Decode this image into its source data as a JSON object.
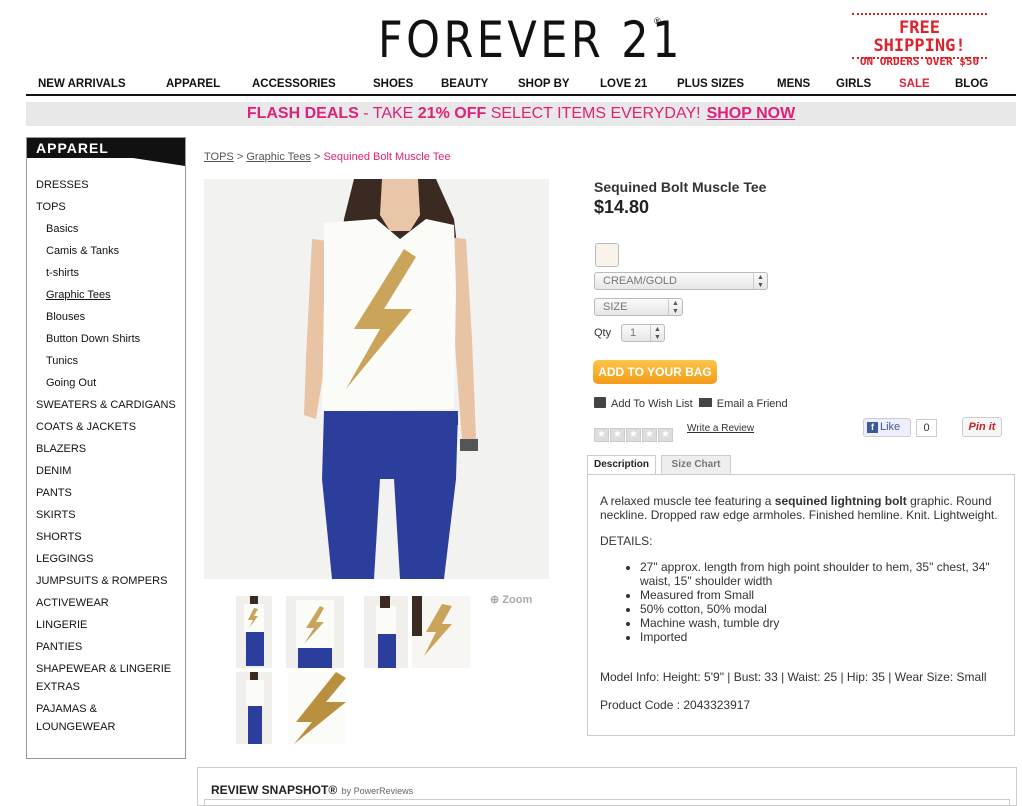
{
  "header": {
    "logo": "FOREVER 21",
    "logo_reg": "®",
    "shipping_line1": "FREE SHIPPING!",
    "shipping_line2": "ON ORDERS OVER $50"
  },
  "nav": {
    "items": [
      "NEW ARRIVALS",
      "APPAREL",
      "ACCESSORIES",
      "SHOES",
      "BEAUTY",
      "SHOP BY",
      "LOVE 21",
      "PLUS SIZES",
      "MENS",
      "GIRLS",
      "SALE",
      "BLOG"
    ]
  },
  "flash": {
    "prefix": "FLASH DEALS",
    "dash": " - TAKE ",
    "pct": "21% OFF",
    "rest": " SELECT ITEMS EVERYDAY!",
    "shop": "SHOP NOW"
  },
  "sidebar": {
    "title": "APPAREL",
    "items": [
      "DRESSES",
      "TOPS",
      "Basics",
      "Camis & Tanks",
      "t-shirts",
      "Graphic Tees",
      "Blouses",
      "Button Down Shirts",
      "Tunics",
      "Going Out",
      "SWEATERS & CARDIGANS",
      "COATS & JACKETS",
      "BLAZERS",
      "DENIM",
      "PANTS",
      "SKIRTS",
      "SHORTS",
      "LEGGINGS",
      "JUMPSUITS & ROMPERS",
      "ACTIVEWEAR",
      "LINGERIE",
      "PANTIES",
      "SHAPEWEAR & LINGERIE",
      "EXTRAS",
      "PAJAMAS &",
      "LOUNGEWEAR"
    ]
  },
  "breadcrumb": {
    "tops": "TOPS",
    "sep1": " > ",
    "graphic": "Graphic Tees",
    "sep2": " > ",
    "current": "Sequined Bolt Muscle Tee"
  },
  "product": {
    "title": "Sequined Bolt Muscle Tee",
    "price": "$14.80",
    "color_select": "CREAM/GOLD",
    "size_select": "SIZE",
    "qty_label": "Qty",
    "qty_value": "1",
    "add_to_bag": "ADD TO YOUR BAG",
    "wishlist": "Add To Wish List",
    "email": "Email a Friend",
    "write_review": "Write a Review",
    "like": "Like",
    "like_count": "0",
    "pinit": "Pin it",
    "zoom": "Zoom",
    "rating": 0,
    "colors": {
      "swatch": "#faf3ea",
      "accent": "#e0207a",
      "button": "#f7a823"
    }
  },
  "tabs": {
    "description": "Description",
    "size_chart": "Size Chart"
  },
  "description": {
    "intro_a": "A relaxed muscle tee featuring a ",
    "intro_bold": "sequined lightning bolt",
    "intro_b": " graphic. Round neckline. Dropped raw edge armholes. Finished hemline. Knit. Lightweight.",
    "details_label": "DETAILS:",
    "details": [
      "27\" approx. length from high point shoulder to hem, 35\" chest, 34\" waist, 15\" shoulder width",
      "Measured from Small",
      "50% cotton, 50% modal",
      "Machine wash, tumble dry",
      "Imported"
    ],
    "model_info": "Model Info: Height: 5'9\" | Bust: 33 | Waist: 25 | Hip: 35 | Wear Size: Small",
    "product_code": "Product Code : 2043323917"
  },
  "review": {
    "title": "REVIEW SNAPSHOT®",
    "by": "by PowerReviews"
  }
}
